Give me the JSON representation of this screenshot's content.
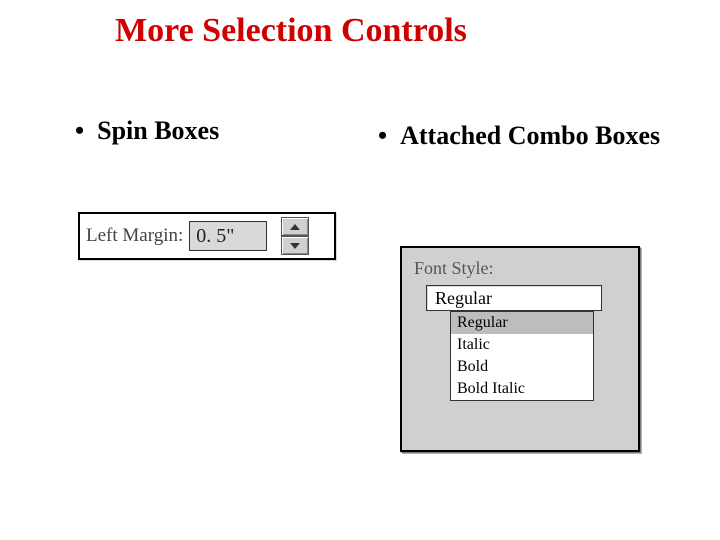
{
  "title": "More Selection Controls",
  "bullets": {
    "left": "Spin Boxes",
    "right": "Attached Combo Boxes"
  },
  "spinbox": {
    "label": "Left Margin:",
    "value": "0. 5\"",
    "icons": {
      "up": "arrow-up",
      "down": "arrow-down"
    }
  },
  "combo": {
    "label": "Font Style:",
    "selected": "Regular",
    "options": [
      {
        "label": "Regular",
        "highlight": true
      },
      {
        "label": "Italic",
        "highlight": false
      },
      {
        "label": "Bold",
        "highlight": false
      },
      {
        "label": "Bold Italic",
        "highlight": false
      }
    ]
  }
}
